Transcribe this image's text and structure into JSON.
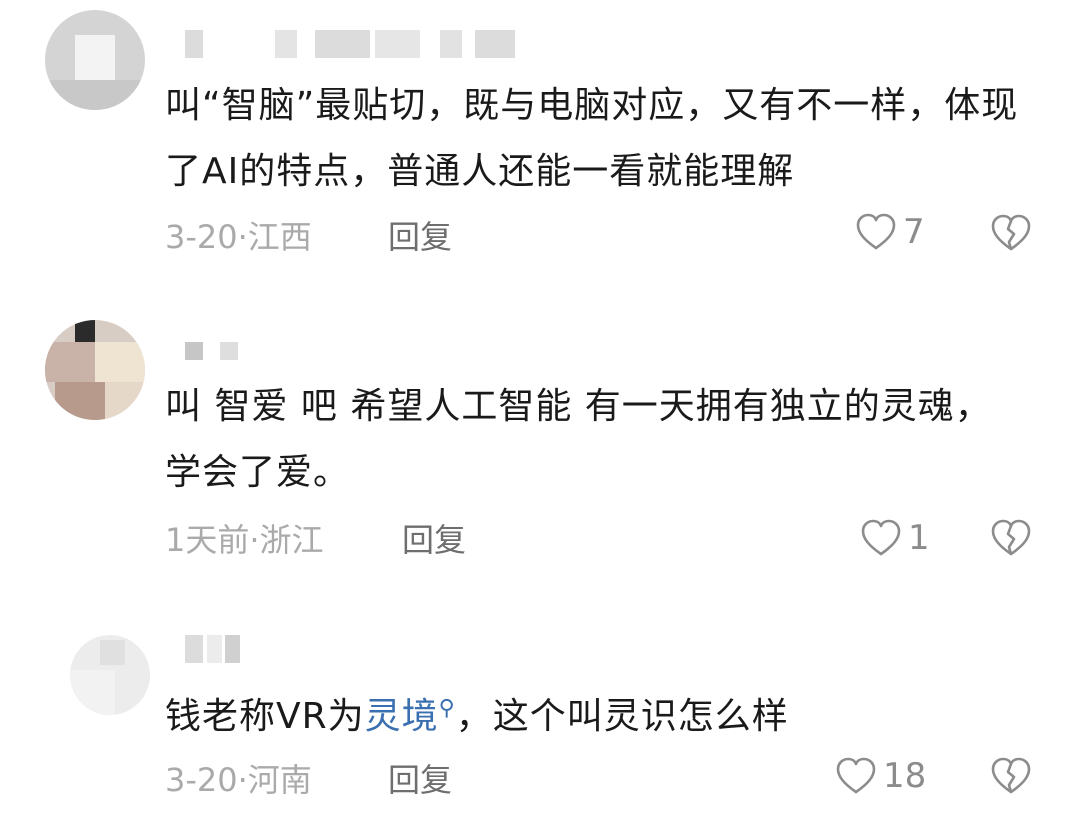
{
  "comments": [
    {
      "text": "叫“智脑”最贴切，既与电脑对应，又有不一样，体现了AI的特点，普通人还能一看就能理解",
      "date": "3-20",
      "separator": "·",
      "region": "江西",
      "reply_label": "回复",
      "likes": "7"
    },
    {
      "text": "叫 智爱 吧  希望人工智能 有一天拥有独立的灵魂，学会了爱。",
      "date": "1天前",
      "separator": "·",
      "region": "浙江",
      "reply_label": "回复",
      "likes": "1"
    },
    {
      "text_before": "钱老称VR为",
      "link_text": "灵境",
      "text_after": "，这个叫灵识怎么样",
      "date": "3-20",
      "separator": "·",
      "region": "河南",
      "reply_label": "回复",
      "likes": "18"
    }
  ],
  "icons": {
    "like": "heart-outline-icon",
    "dislike": "broken-heart-icon",
    "link_search": "search-icon"
  },
  "colors": {
    "text": "#1a1a1a",
    "meta": "#aaaaaa",
    "reply": "#6e6e6e",
    "link": "#3a6fb0"
  }
}
